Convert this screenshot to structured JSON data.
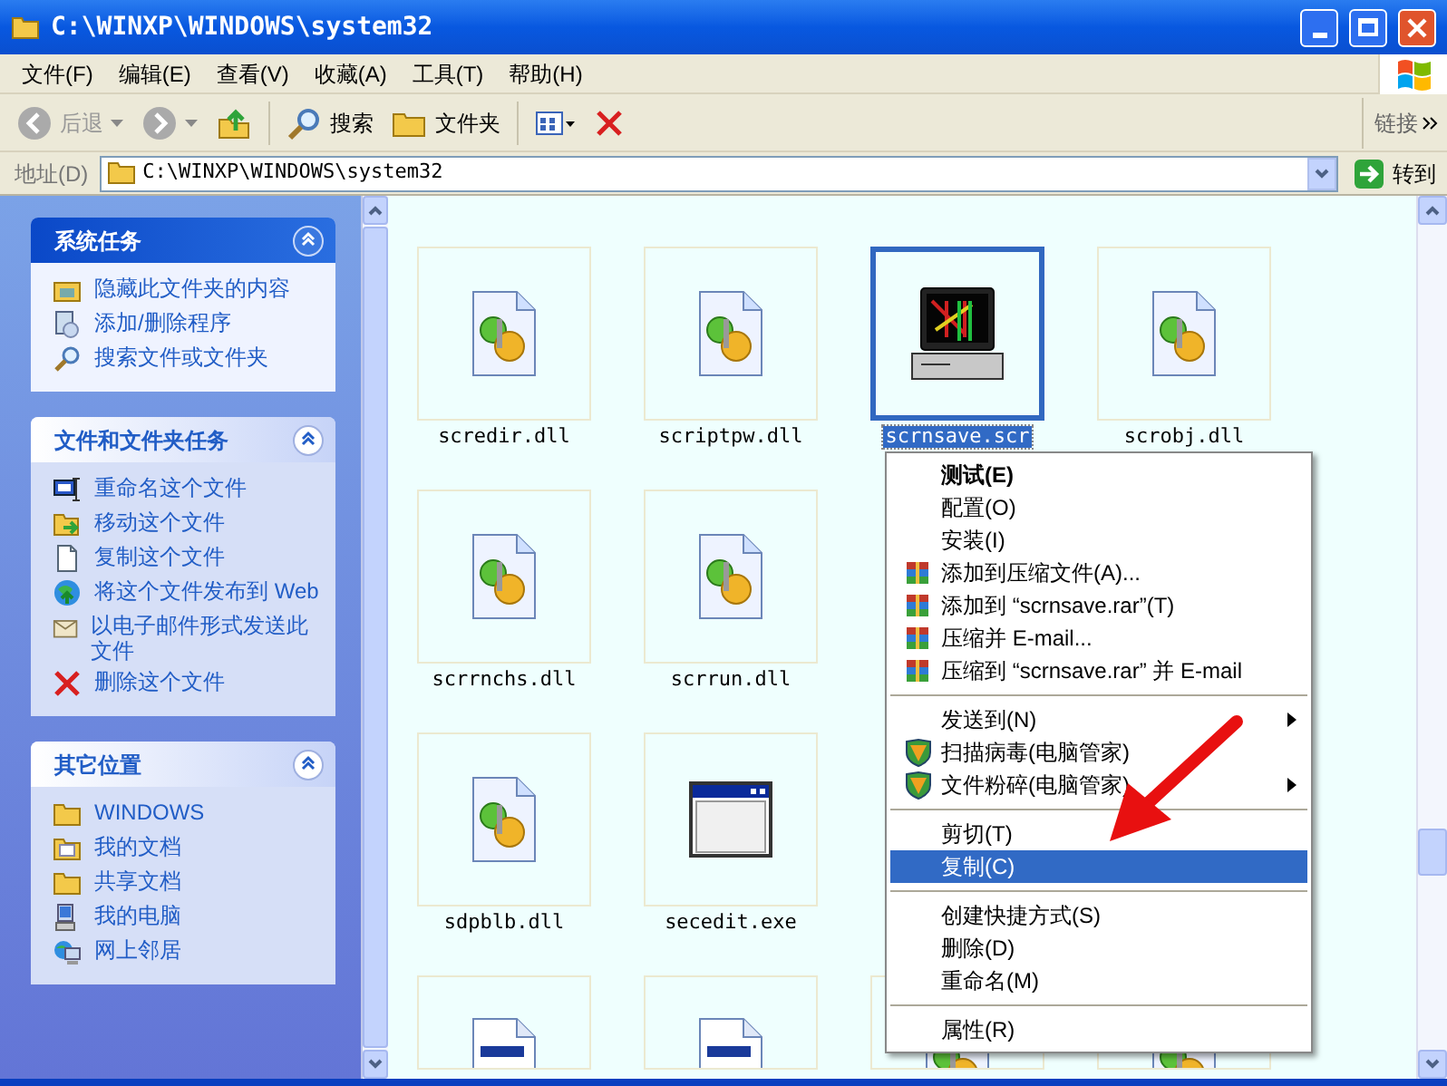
{
  "window": {
    "title": "C:\\WINXP\\WINDOWS\\system32"
  },
  "menu_bar": [
    "文件(F)",
    "编辑(E)",
    "查看(V)",
    "收藏(A)",
    "工具(T)",
    "帮助(H)"
  ],
  "toolbar": [
    {
      "kind": "back",
      "label": "后退",
      "disabled": true
    },
    {
      "kind": "forward",
      "disabled": true
    },
    {
      "kind": "up"
    },
    {
      "kind": "search",
      "label": "搜索"
    },
    {
      "kind": "folders",
      "label": "文件夹"
    },
    {
      "kind": "views"
    },
    {
      "kind": "delete"
    }
  ],
  "links": {
    "label": "链接"
  },
  "address_bar": {
    "label": "地址(D)",
    "value": "C:\\WINXP\\WINDOWS\\system32",
    "go": "转到"
  },
  "task_pane": [
    {
      "title": "系统任务",
      "expanded": true,
      "items": [
        {
          "label": "隐藏此文件夹的内容"
        },
        {
          "label": "添加/删除程序"
        },
        {
          "label": "搜索文件或文件夹"
        }
      ]
    },
    {
      "title": "文件和文件夹任务",
      "expanded": true,
      "items": [
        {
          "label": "重命名这个文件"
        },
        {
          "label": "移动这个文件"
        },
        {
          "label": "复制这个文件"
        },
        {
          "label": "将这个文件发布到 Web"
        },
        {
          "label": "以电子邮件形式发送此文件"
        },
        {
          "label": "删除这个文件"
        }
      ]
    },
    {
      "title": "其它位置",
      "expanded": true,
      "items": [
        {
          "label": "WINDOWS"
        },
        {
          "label": "我的文档"
        },
        {
          "label": "共享文档"
        },
        {
          "label": "我的电脑"
        },
        {
          "label": "网上邻居"
        }
      ]
    }
  ],
  "files": [
    {
      "kind": "dll",
      "name": "scredir.dll",
      "selected": false
    },
    {
      "kind": "dll",
      "name": "scriptpw.dll",
      "selected": false
    },
    {
      "kind": "scr",
      "name": "scrnsave.scr",
      "selected": true
    },
    {
      "kind": "dll",
      "name": "scrobj.dll",
      "selected": false
    },
    {
      "kind": "dll",
      "name": "scrrnchs.dll",
      "selected": false
    },
    {
      "kind": "dll",
      "name": "scrrun.dll",
      "selected": false
    },
    {
      "kind": "hidden"
    },
    {
      "kind": "hidden"
    },
    {
      "kind": "dll",
      "name": "sdpblb.dll",
      "selected": false
    },
    {
      "kind": "exe",
      "name": "secedit.exe",
      "selected": false
    },
    {
      "kind": "hidden"
    },
    {
      "kind": "hidden"
    },
    {
      "kind": "doc",
      "selected": false
    },
    {
      "kind": "doc",
      "selected": false
    },
    {
      "kind": "dll",
      "selected": false
    },
    {
      "kind": "dll",
      "selected": false
    }
  ],
  "context_menu": [
    {
      "kind": "item",
      "label": "测试(E)",
      "bold": true,
      "selected": false
    },
    {
      "kind": "item",
      "label": "配置(O)",
      "selected": false
    },
    {
      "kind": "item",
      "label": "安装(I)",
      "selected": false
    },
    {
      "kind": "archive",
      "label": "添加到压缩文件(A)...",
      "selected": false
    },
    {
      "kind": "archive",
      "label": "添加到 “scrnsave.rar”(T)",
      "selected": false
    },
    {
      "kind": "archive",
      "label": "压缩并 E-mail...",
      "selected": false
    },
    {
      "kind": "archive",
      "label": "压缩到 “scrnsave.rar” 并 E-mail",
      "selected": false
    },
    {
      "kind": "separator"
    },
    {
      "kind": "item",
      "label": "发送到(N)",
      "submenu": true,
      "selected": false
    },
    {
      "kind": "shield",
      "label": "扫描病毒(电脑管家)",
      "selected": false
    },
    {
      "kind": "shield",
      "label": "文件粉碎(电脑管家)",
      "submenu": true,
      "selected": false
    },
    {
      "kind": "separator"
    },
    {
      "kind": "item",
      "label": "剪切(T)",
      "selected": false
    },
    {
      "kind": "item",
      "label": "复制(C)",
      "selected": true
    },
    {
      "kind": "separator"
    },
    {
      "kind": "item",
      "label": "创建快捷方式(S)",
      "selected": false
    },
    {
      "kind": "item",
      "label": "删除(D)",
      "selected": false
    },
    {
      "kind": "item",
      "label": "重命名(M)",
      "selected": false
    },
    {
      "kind": "separator"
    },
    {
      "kind": "item",
      "label": "属性(R)",
      "selected": false
    }
  ],
  "annotation": {
    "kind": "arrow"
  }
}
